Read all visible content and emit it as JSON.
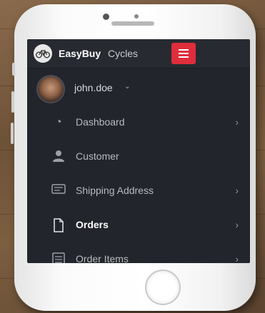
{
  "app": {
    "brand_bold": "EasyBuy",
    "brand_light": "Cycles",
    "logo_icon": "bicycle-logo-icon",
    "accent_color": "#e02d3c"
  },
  "user": {
    "name": "john.doe",
    "caret": "⌄"
  },
  "nav": {
    "items": [
      {
        "label": "Dashboard",
        "icon": "pie-chart-icon",
        "glyph": "◔",
        "has_chevron": true
      },
      {
        "label": "Customer",
        "icon": "user-icon",
        "glyph": "👤",
        "has_chevron": false
      },
      {
        "label": "Shipping Address",
        "icon": "address-card-icon",
        "glyph": "▤",
        "has_chevron": true
      },
      {
        "label": "Orders",
        "icon": "document-icon",
        "glyph": "🗋",
        "has_chevron": true,
        "active": true
      },
      {
        "label": "Order Items",
        "icon": "list-icon",
        "glyph": "☰",
        "has_chevron": true
      }
    ],
    "chevron": "›"
  }
}
